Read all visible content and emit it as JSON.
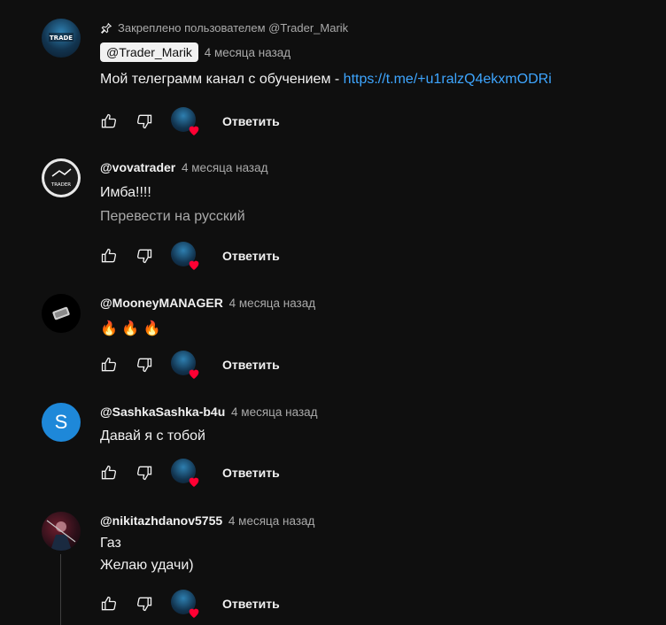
{
  "comments": [
    {
      "pinned_label": "Закреплено пользователем @Trader_Marik",
      "author": "@Trader_Marik",
      "time": "4 месяца назад",
      "text_prefix": "Мой телеграмм канал с обучением - ",
      "link": "https://t.me/+u1ralzQ4ekxmODRi",
      "reply": "Ответить"
    },
    {
      "author": "@vovatrader",
      "time": "4 месяца назад",
      "text": "Имба!!!!",
      "translate": "Перевести на русский",
      "reply": "Ответить"
    },
    {
      "author": "@MooneyMANAGER",
      "time": "4 месяца назад",
      "text": "🔥 🔥 🔥",
      "reply": "Ответить"
    },
    {
      "author": "@SashkaSashka-b4u",
      "time": "4 месяца назад",
      "avatar_letter": "S",
      "text": "Давай я с тобой",
      "reply": "Ответить"
    },
    {
      "author": "@nikitazhdanov5755",
      "time": "4 месяца назад",
      "text_line1": "Газ",
      "text_line2": "Желаю удачи)",
      "reply": "Ответить"
    }
  ],
  "colors": {
    "background": "#0f0f0f",
    "link": "#3ea6ff",
    "heart": "#ff0033",
    "secondary_text": "#aaaaaa"
  }
}
